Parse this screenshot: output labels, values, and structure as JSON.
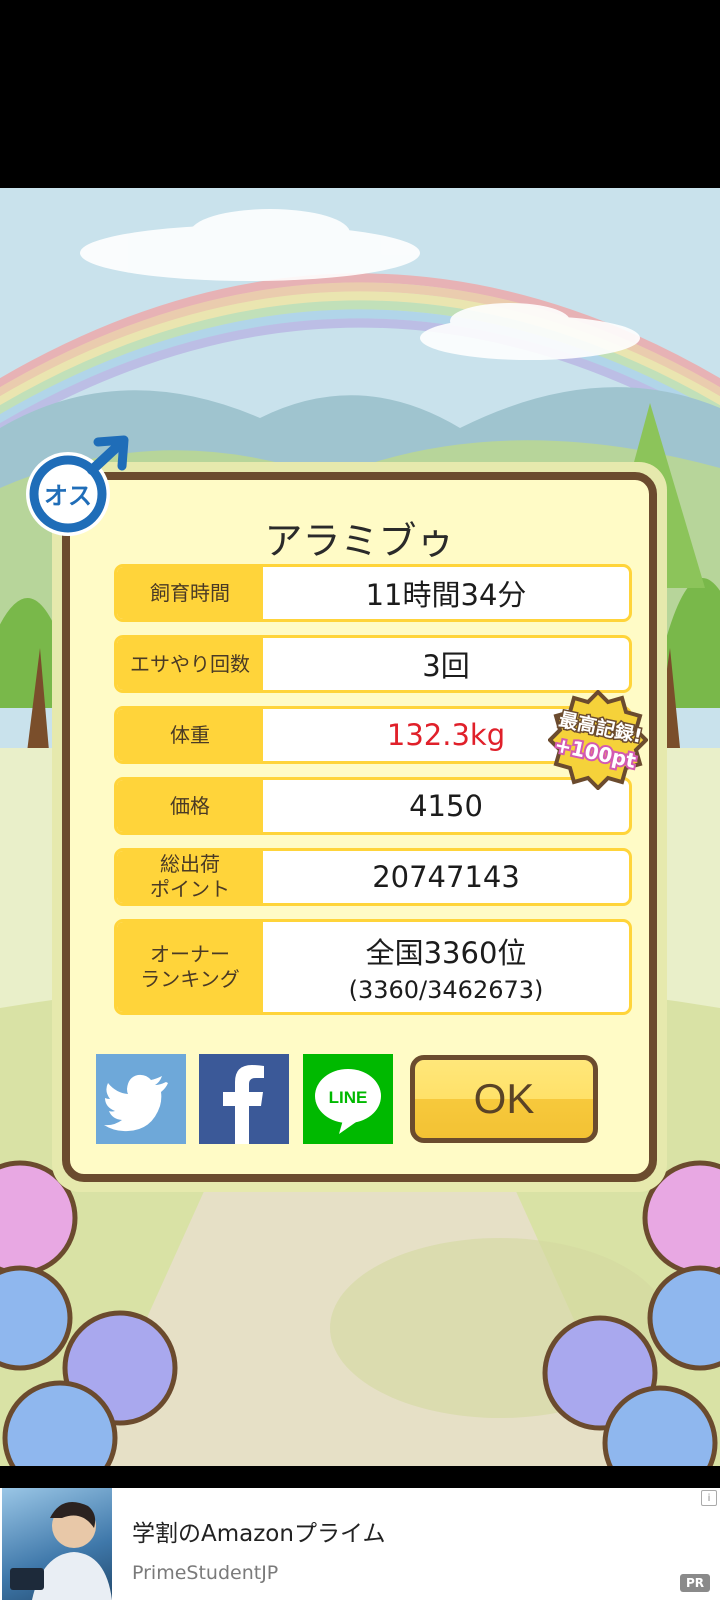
{
  "pet": {
    "name": "アラミブゥ",
    "gender_label": "オス"
  },
  "stats": [
    {
      "label": "飼育時間",
      "value": "11時間34分"
    },
    {
      "label": "エサやり回数",
      "value": "3回"
    },
    {
      "label": "体重",
      "value": "132.3kg",
      "highlight": "#e0202a"
    },
    {
      "label": "価格",
      "value": "4150"
    },
    {
      "label": "総出荷\nポイント",
      "value": "20747143"
    },
    {
      "label": "オーナー\nランキング",
      "value": "全国3360位",
      "sub": "(3360/3462673)"
    }
  ],
  "record_badge": {
    "line1": "最高記録!",
    "line2": "+100pt"
  },
  "share": {
    "twitter_icon": "twitter-bird-icon",
    "facebook_icon": "facebook-f-icon",
    "line_label": "LINE"
  },
  "ok_label": "OK",
  "ad": {
    "title": "学割のAmazonプライム",
    "advertiser": "PrimeStudentJP",
    "pr_label": "PR",
    "info_label": "i"
  },
  "colors": {
    "label_bg": "#ffd43a",
    "frame": "#6b4b2e",
    "panel": "#fffbc6",
    "twitter": "#6ea8d9",
    "facebook": "#3b5998",
    "line": "#00b900"
  }
}
